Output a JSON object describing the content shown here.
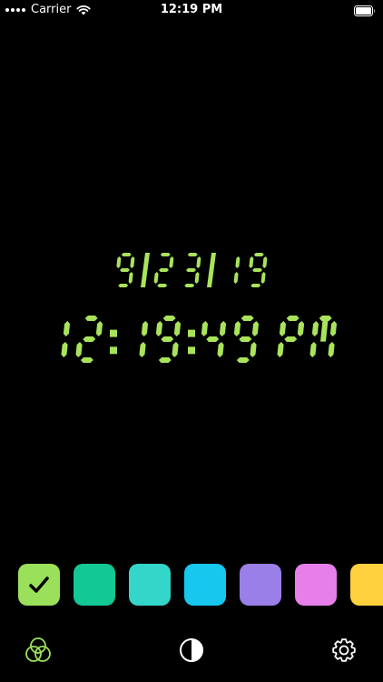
{
  "status_bar": {
    "carrier": "Carrier",
    "time": "12:19 PM",
    "signal_icon": "signal-dots-icon",
    "wifi_icon": "wifi-icon",
    "battery_icon": "battery-icon"
  },
  "clock": {
    "date": "9/23/19",
    "time": "12:19:49 PM",
    "color": "#a9e35b"
  },
  "swatches": [
    {
      "color": "#9ae05a",
      "selected": true
    },
    {
      "color": "#12c895",
      "selected": false
    },
    {
      "color": "#33d6c9",
      "selected": false
    },
    {
      "color": "#17c7ee",
      "selected": false
    },
    {
      "color": "#9b7fe8",
      "selected": false
    },
    {
      "color": "#e77fea",
      "selected": false
    },
    {
      "color": "#ffd13f",
      "selected": false
    }
  ],
  "toolbar": {
    "left_icon": "color-circles-icon",
    "center_icon": "contrast-icon",
    "right_icon": "gear-icon",
    "accent": "#9ae05a"
  }
}
